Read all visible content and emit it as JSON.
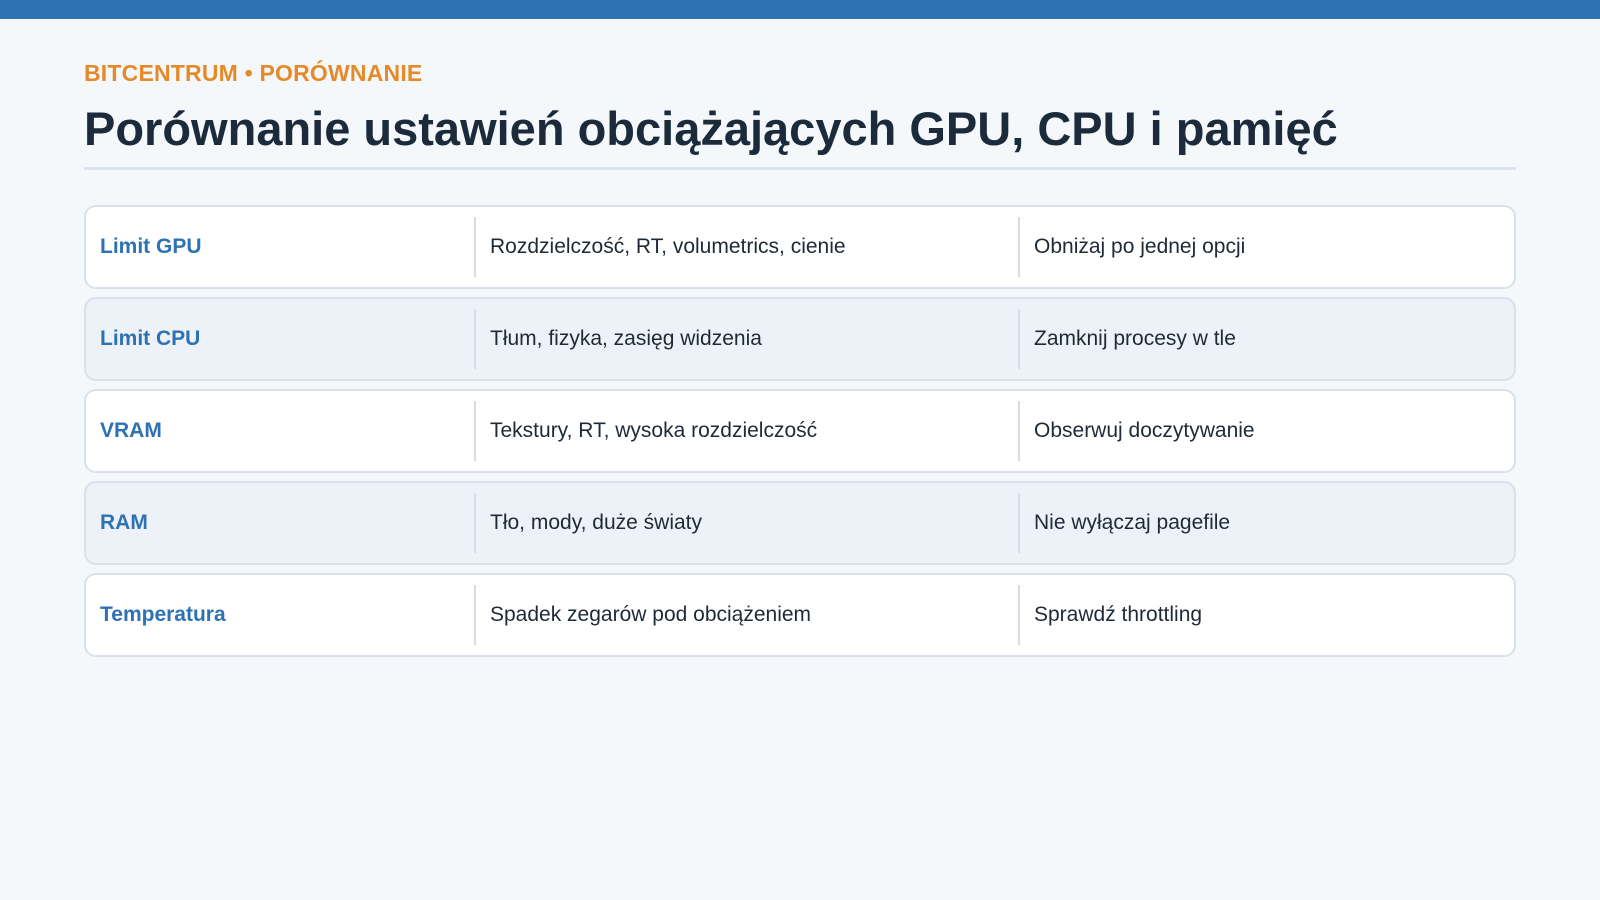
{
  "header": {
    "eyebrow": "BITCENTRUM • PORÓWNANIE",
    "title": "Porównanie ustawień obciążających GPU, CPU i pamięć"
  },
  "rows": [
    {
      "label": "Limit GPU",
      "cause": "Rozdzielczość, RT, volumetrics, cienie",
      "action": "Obniżaj po jednej opcji"
    },
    {
      "label": "Limit CPU",
      "cause": "Tłum, fizyka, zasięg widzenia",
      "action": "Zamknij procesy w tle"
    },
    {
      "label": "VRAM",
      "cause": "Tekstury, RT, wysoka rozdzielczość",
      "action": "Obserwuj doczytywanie"
    },
    {
      "label": "RAM",
      "cause": "Tło, mody, duże światy",
      "action": "Nie wyłączaj pagefile"
    },
    {
      "label": "Temperatura",
      "cause": "Spadek zegarów pod obciążeniem",
      "action": "Sprawdź throttling"
    }
  ],
  "colors": {
    "accent": "#2e72b3",
    "eyebrow": "#e48a2a",
    "title": "#1c2b3c"
  }
}
